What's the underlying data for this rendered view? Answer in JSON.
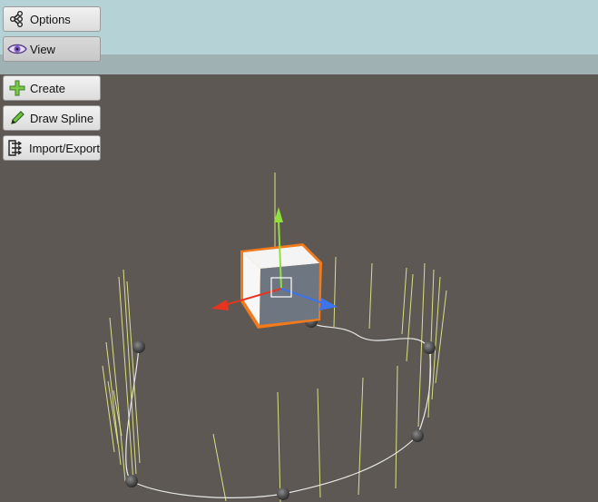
{
  "toolbar": {
    "options_label": "Options",
    "view_label": "View",
    "create_label": "Create",
    "draw_spline_label": "Draw Spline",
    "import_export_label": "Import/Export"
  },
  "icons": {
    "options": "node-tree-icon",
    "view": "eye-icon",
    "create": "plus-icon",
    "draw_spline": "pencil-icon",
    "import_export": "import-export-icon"
  },
  "colors": {
    "viewport_background": "#5d5853",
    "selection_outline": "#f07a1c",
    "gizmo_x": "#e8341f",
    "gizmo_y": "#8fe03a",
    "gizmo_z": "#3d74e8",
    "spline_stems": "#e9ee8a",
    "spline_curve": "#e8e8e8"
  }
}
